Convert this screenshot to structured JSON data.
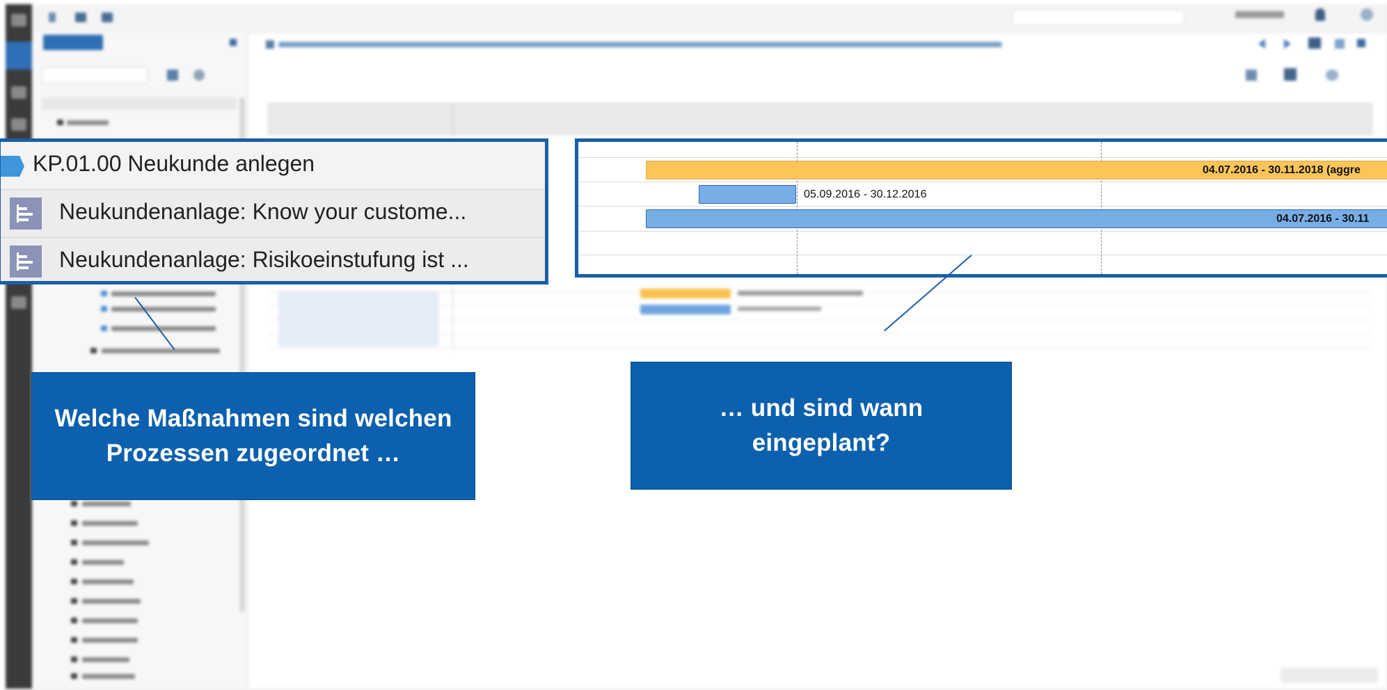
{
  "tree_zoom": {
    "rows": [
      {
        "label": "KP.01.00 Neukunde anlegen",
        "icon": "process-icon"
      },
      {
        "label": "Neukundenanlage: Know your custome...",
        "icon": "task-icon"
      },
      {
        "label": "Neukundenanlage: Risikoeinstufung ist ...",
        "icon": "task-icon"
      }
    ]
  },
  "gantt_zoom": {
    "bars": [
      {
        "label": "04.07.2016 - 30.11.2018 (aggre",
        "color": "#fbc55a"
      },
      {
        "label": "05.09.2016 - 30.12.2016",
        "color": "#78aee6"
      },
      {
        "label": "04.07.2016 - 30.11",
        "color": "#78aee6"
      }
    ]
  },
  "callouts": {
    "left_line1": "Welche Maßnahmen sind welchen",
    "left_line2": "Prozessen zugeordnet …",
    "right_line1": "… und sind wann",
    "right_line2": "eingeplant?"
  },
  "colors": {
    "accent": "#1a5ea9",
    "callout_bg": "#0d60ad",
    "bar_orange": "#fbc55a",
    "bar_blue": "#78aee6"
  }
}
